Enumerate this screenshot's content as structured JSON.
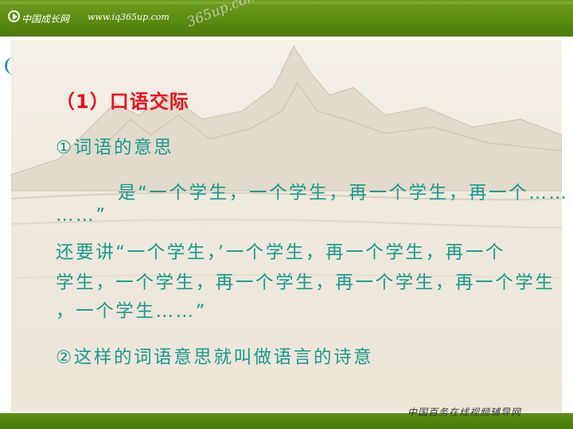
{
  "header": {
    "site_name": "中国成长网",
    "site_url": "www.iq365up.com",
    "watermark": "365up.com"
  },
  "slide": {
    "heading": "（1）口语交际",
    "item1": "①词语的意思",
    "quote_line1_prefix": "是“",
    "quote_line1_body": "一个学生，一个学生，再一个学生，再一个……",
    "quote_line2": "……”",
    "quote_line3_prefix": "还要讲“",
    "quote_line3_quote": "一个学生，",
    "quote_line3_rest": "’一个学生，再一个学生，再一个",
    "quote_line4": "学生，一个学生，再一个学生，再一个学生，再一个学生",
    "quote_line5": "，一个学生……”",
    "item2": "②这样的词语意思就叫做语言的诗意"
  },
  "footer": {
    "text": "中国百务在线视频辅导网"
  },
  "colors": {
    "banner_green": "#5a8c12",
    "heading_red": "#e8141e",
    "body_teal": "#179a8c"
  }
}
